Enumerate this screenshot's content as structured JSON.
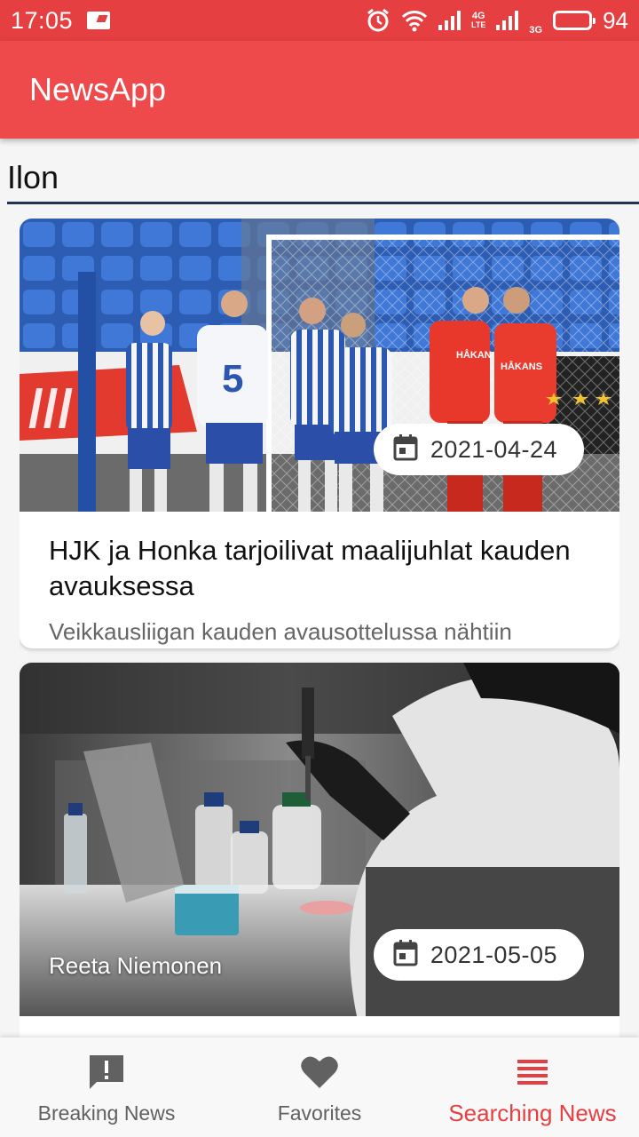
{
  "status_bar": {
    "time": "17:05",
    "network_4g": "4G",
    "network_lte": "LTE",
    "network_3g": "3G",
    "battery": "94"
  },
  "app_bar": {
    "title": "NewsApp"
  },
  "search": {
    "query": "Ilon"
  },
  "articles": [
    {
      "title": "HJK ja Honka tarjoilivat maalijuhlat kauden avauksessa",
      "description": "Veikkausliigan kauden avausottelussa nähtiin",
      "date": "2021-04-24",
      "author": "",
      "image": "football-players-photo"
    },
    {
      "title": "",
      "description": "",
      "date": "2021-05-05",
      "author": "Reeta Niemonen",
      "image": "lab-pipette-photo"
    }
  ],
  "bottom_nav": {
    "items": [
      {
        "label": "Breaking News",
        "icon": "alert-message-icon",
        "active": false
      },
      {
        "label": "Favorites",
        "icon": "heart-icon",
        "active": false
      },
      {
        "label": "Searching News",
        "icon": "list-icon",
        "active": true
      }
    ]
  },
  "colors": {
    "status_bar": "#e53f41",
    "app_bar": "#ee4a4c",
    "accent": "#e53f41",
    "search_underline": "#1f3552"
  }
}
